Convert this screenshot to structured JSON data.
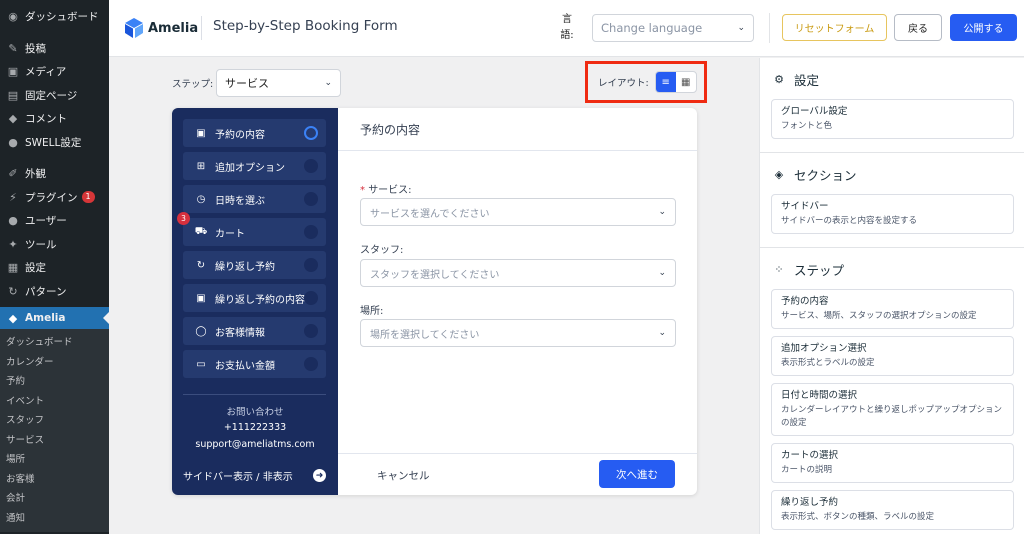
{
  "wp_menu": {
    "dashboard": "ダッシュボード",
    "posts": "投稿",
    "media": "メディア",
    "pages": "固定ページ",
    "comments": "コメント",
    "swell": "SWELL設定",
    "appearance": "外観",
    "plugins": "プラグイン",
    "plugins_badge": "1",
    "users": "ユーザー",
    "tools": "ツール",
    "settings": "設定",
    "patterns": "パターン",
    "amelia": "Amelia",
    "submenu": [
      "ダッシュボード",
      "カレンダー",
      "予約",
      "イベント",
      "スタッフ",
      "サービス",
      "場所",
      "お客様",
      "会計",
      "通知"
    ]
  },
  "topbar": {
    "logo": "Amelia",
    "title": "Step-by-Step Booking Form",
    "lang_label": "言語:",
    "lang_placeholder": "Change language",
    "reset": "リセットフォーム",
    "back": "戻る",
    "publish": "公開する"
  },
  "toolbar": {
    "step_label": "ステップ:",
    "step_value": "サービス",
    "layout_label": "レイアウト:"
  },
  "form": {
    "steps": [
      {
        "label": "予約の内容",
        "icon": "calendar-icon"
      },
      {
        "label": "追加オプション",
        "icon": "plus-square-icon"
      },
      {
        "label": "日時を選ぶ",
        "icon": "clock-calendar-icon"
      },
      {
        "label": "カート",
        "icon": "cart-icon",
        "badge": "3"
      },
      {
        "label": "繰り返し予約",
        "icon": "repeat-calendar-icon"
      },
      {
        "label": "繰り返し予約の内容",
        "icon": "calendar-check-icon"
      },
      {
        "label": "お客様情報",
        "icon": "user-icon"
      },
      {
        "label": "お支払い金額",
        "icon": "card-icon"
      }
    ],
    "contact_title": "お問い合わせ",
    "contact_phone": "+111222333",
    "contact_email": "support@ameliatms.com",
    "sidebar_toggle": "サイドバー表示 / 非表示",
    "heading": "予約の内容",
    "fields": [
      {
        "label": "サービス:",
        "required": true,
        "placeholder": "サービスを選んでください"
      },
      {
        "label": "スタッフ:",
        "required": false,
        "placeholder": "スタッフを選択してください"
      },
      {
        "label": "場所:",
        "required": false,
        "placeholder": "場所を選択してください"
      }
    ],
    "cancel": "キャンセル",
    "next": "次へ進む"
  },
  "settings": {
    "settings_title": "設定",
    "global_title": "グローバル設定",
    "global_desc": "フォントと色",
    "sections_title": "セクション",
    "sidebar_title": "サイドバー",
    "sidebar_desc": "サイドバーの表示と内容を設定する",
    "steps_title": "ステップ",
    "step_cards": [
      {
        "title": "予約の内容",
        "desc": "サービス、場所、スタッフの選択オプションの設定"
      },
      {
        "title": "追加オプション選択",
        "desc": "表示形式とラベルの設定"
      },
      {
        "title": "日付と時間の選択",
        "desc": "カレンダーレイアウトと繰り返しポップアップオプションの設定"
      },
      {
        "title": "カートの選択",
        "desc": "カートの説明"
      },
      {
        "title": "繰り返し予約",
        "desc": "表示形式、ボタンの種類、ラベルの設定"
      }
    ]
  },
  "colors": {
    "wp_sidebar": "#1d2327",
    "accent": "#265cf2",
    "form_sidebar": "#1a2c5e",
    "highlight": "#ef2b12"
  }
}
